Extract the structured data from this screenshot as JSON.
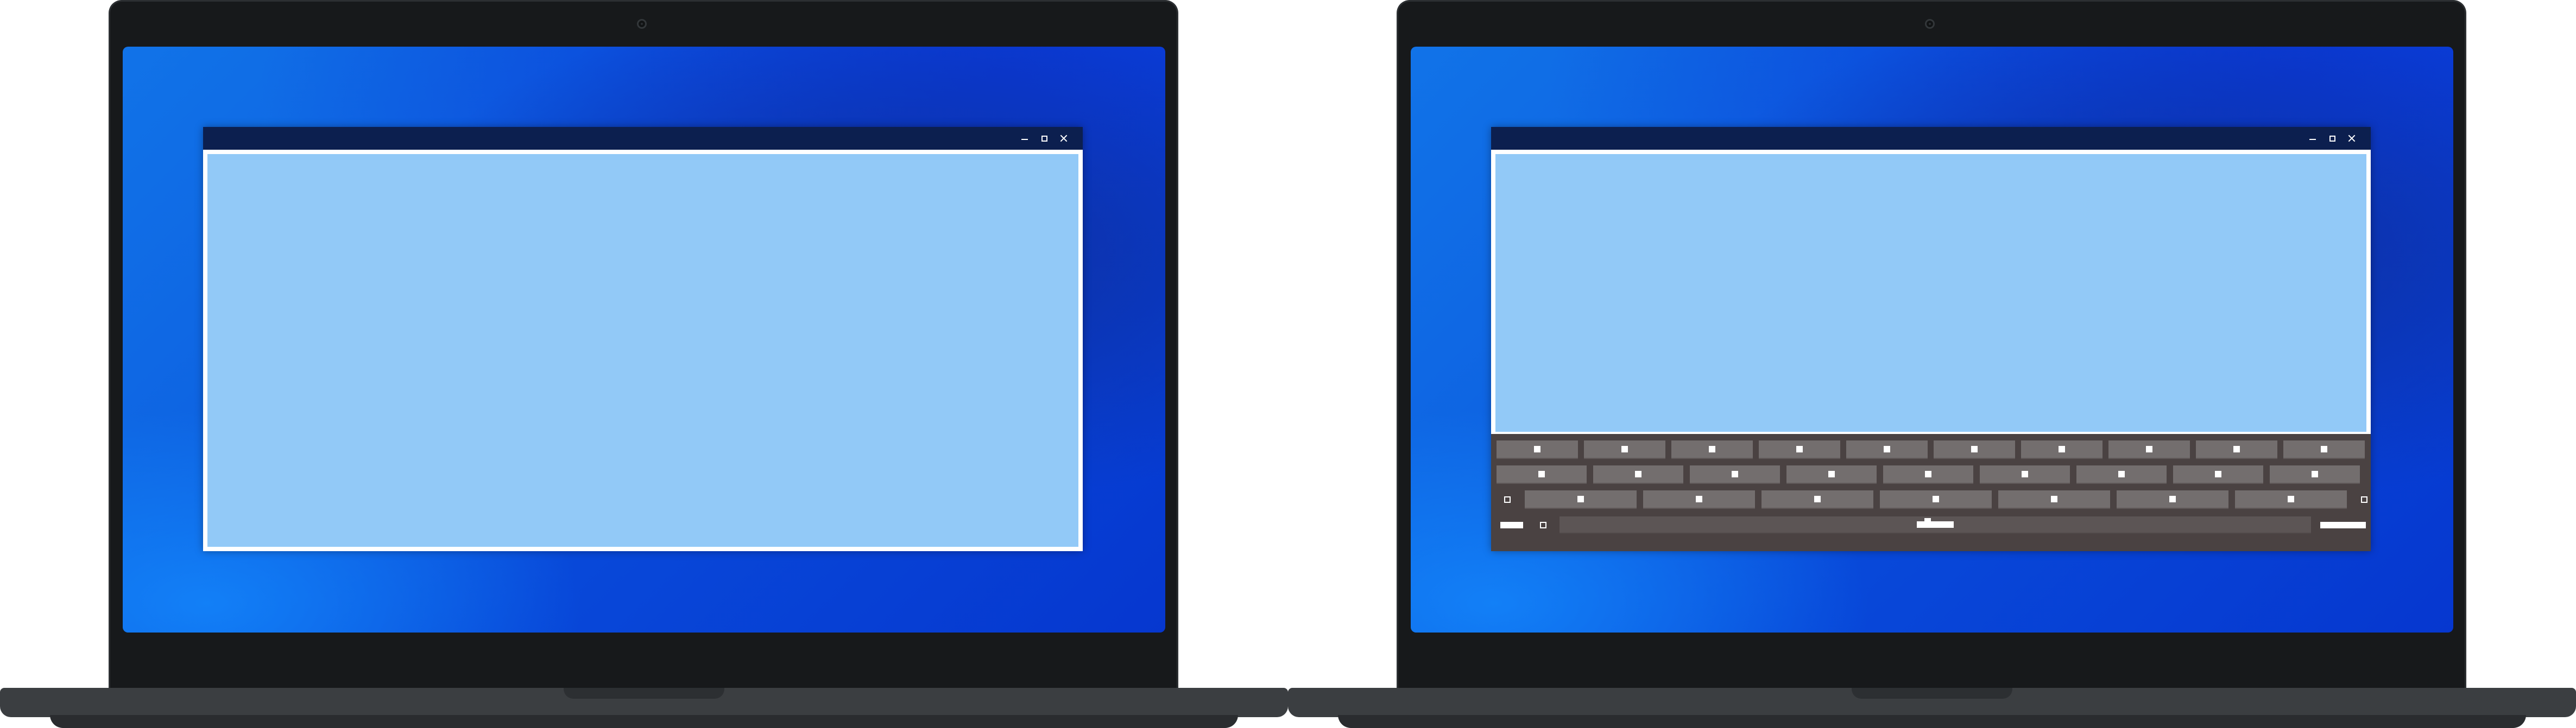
{
  "devices": [
    {
      "id": "left",
      "window": {
        "title": "",
        "controls": {
          "minimize": "minimize",
          "maximize": "maximize",
          "close": "close"
        },
        "content_color": "#92c9f7",
        "keyboard_visible": false
      }
    },
    {
      "id": "right",
      "window": {
        "title": "",
        "controls": {
          "minimize": "minimize",
          "maximize": "maximize",
          "close": "close"
        },
        "content_color": "#92c9f7",
        "keyboard_visible": true
      },
      "keyboard": {
        "rows": [
          10,
          9,
          7
        ],
        "edge_keys": [
          "left-edge-icon",
          "right-edge-icon"
        ],
        "bottom_row": [
          "wide-key-icon",
          "small-key-icon",
          "space-bar-icon",
          "enter-wide-key-icon"
        ]
      }
    }
  ],
  "colors": {
    "wallpaper_start": "#1173e8",
    "wallpaper_end": "#0637cf",
    "titlebar": "#0c1f4f",
    "keyboard_bg": "#4a4242",
    "key_bg": "#736e6e",
    "bezel": "#17191b",
    "chassis": "#3b3e41"
  }
}
